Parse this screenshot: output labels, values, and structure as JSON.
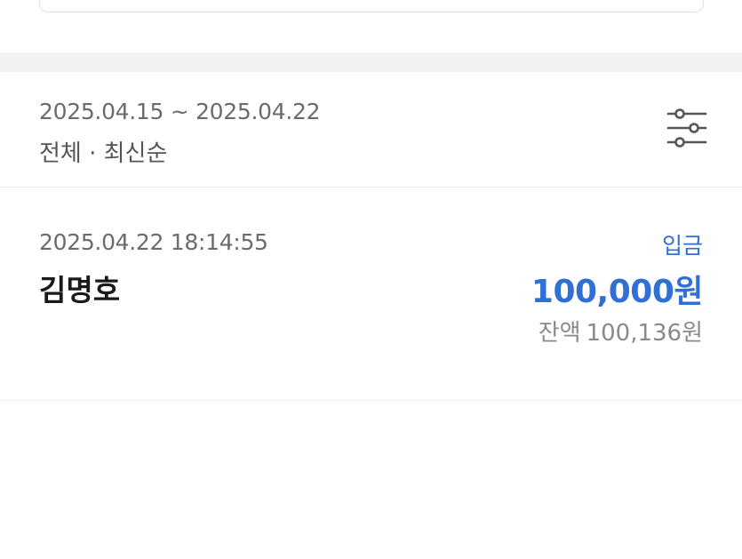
{
  "filter": {
    "date_range": "2025.04.15 ~ 2025.04.22",
    "summary": "전체 · 최신순",
    "filter_icon": "sliders-icon"
  },
  "transactions": [
    {
      "datetime": "2025.04.22 18:14:55",
      "name": "김명호",
      "type": "입금",
      "amount": "100,000원",
      "balance_label": "잔액",
      "balance": "100,136원"
    }
  ],
  "colors": {
    "accent_blue": "#2f6fd6",
    "secondary_text": "#6b6b6b",
    "band_gray": "#f2f2f3"
  }
}
